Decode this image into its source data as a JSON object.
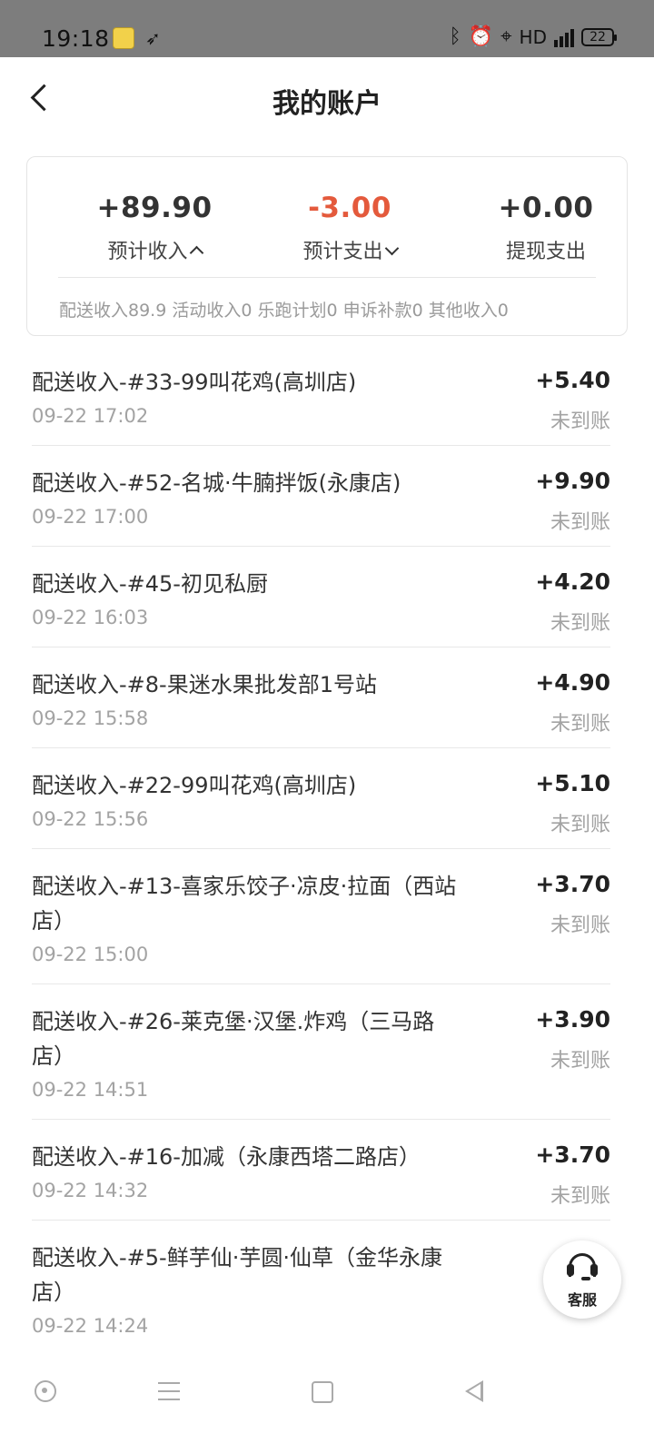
{
  "status_bar": {
    "time": "19:18",
    "network": "HD",
    "battery": "22",
    "icons": [
      "app-icon",
      "plane-icon",
      "bluetooth-icon",
      "alarm-icon",
      "location-icon",
      "signal-icon",
      "battery-icon"
    ]
  },
  "header": {
    "title": "我的账户"
  },
  "summary": {
    "income_value": "+89.90",
    "income_label": "预计收入",
    "expense_value": "-3.00",
    "expense_label": "预计支出",
    "withdraw_value": "+0.00",
    "withdraw_label": "提现支出",
    "detail": "配送收入89.9 活动收入0 乐跑计划0 申诉补款0 其他收入0",
    "negative_color": "#e45a3c"
  },
  "transactions": [
    {
      "title": "配送收入-#33-99叫花鸡(高圳店)",
      "time": "09-22 17:02",
      "amount": "+5.40",
      "status": "未到账"
    },
    {
      "title": "配送收入-#52-名城·牛腩拌饭(永康店)",
      "time": "09-22 17:00",
      "amount": "+9.90",
      "status": "未到账"
    },
    {
      "title": "配送收入-#45-初见私厨",
      "time": "09-22 16:03",
      "amount": "+4.20",
      "status": "未到账"
    },
    {
      "title": "配送收入-#8-果迷水果批发部1号站",
      "time": "09-22 15:58",
      "amount": "+4.90",
      "status": "未到账"
    },
    {
      "title": "配送收入-#22-99叫花鸡(高圳店)",
      "time": "09-22 15:56",
      "amount": "+5.10",
      "status": "未到账"
    },
    {
      "title": "配送收入-#13-喜家乐饺子·凉皮·拉面（西站店）",
      "time": "09-22 15:00",
      "amount": "+3.70",
      "status": "未到账"
    },
    {
      "title": "配送收入-#26-莱克堡·汉堡.炸鸡（三马路店）",
      "time": "09-22 14:51",
      "amount": "+3.90",
      "status": "未到账"
    },
    {
      "title": "配送收入-#16-加减（永康西塔二路店）",
      "time": "09-22 14:32",
      "amount": "+3.70",
      "status": "未到账"
    },
    {
      "title": "配送收入-#5-鲜芋仙·芋圆·仙草（金华永康店）",
      "time": "09-22 14:24",
      "amount": "",
      "status": ""
    }
  ],
  "customer_service": {
    "label": "客服"
  }
}
